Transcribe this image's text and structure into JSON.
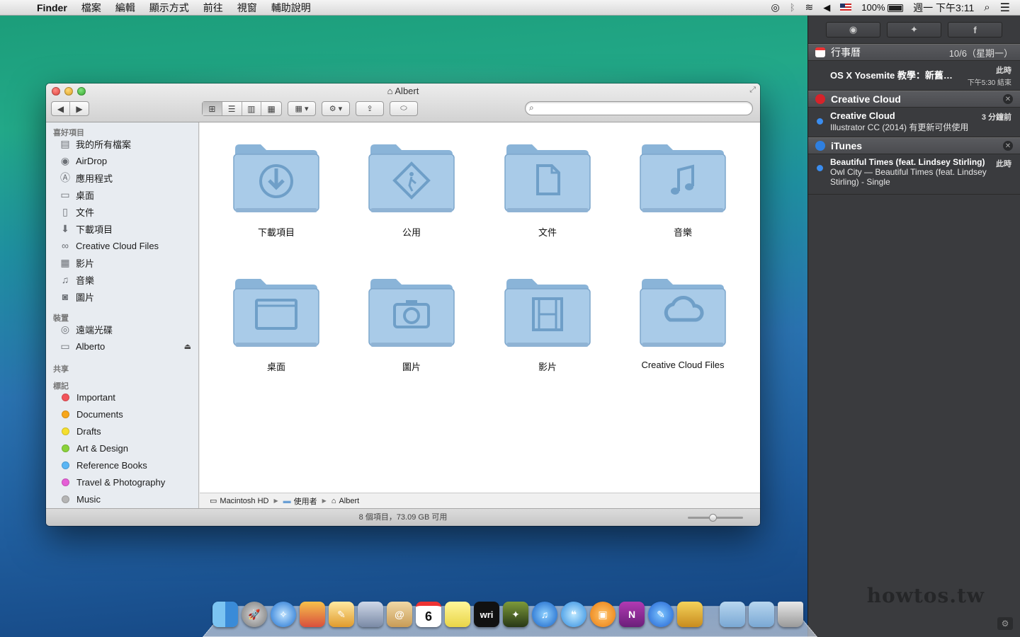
{
  "menubar": {
    "app": "Finder",
    "items": [
      "檔案",
      "編輯",
      "顯示方式",
      "前往",
      "視窗",
      "輔助說明"
    ],
    "battery": "100%",
    "clock": "週一 下午3:11"
  },
  "finder": {
    "title": "Albert",
    "search_placeholder": "",
    "sidebar": {
      "favorites_header": "喜好項目",
      "favorites": [
        "我的所有檔案",
        "AirDrop",
        "應用程式",
        "桌面",
        "文件",
        "下載項目",
        "Creative Cloud Files",
        "影片",
        "音樂",
        "圖片"
      ],
      "devices_header": "裝置",
      "devices": [
        "遠端光碟",
        "Alberto"
      ],
      "shared_header": "共享",
      "tags_header": "標記",
      "tags": [
        {
          "label": "Important",
          "color": "#f2545b"
        },
        {
          "label": "Documents",
          "color": "#f7a61b"
        },
        {
          "label": "Drafts",
          "color": "#f5df2e"
        },
        {
          "label": "Art & Design",
          "color": "#8ad23a"
        },
        {
          "label": "Reference Books",
          "color": "#5ab6f5"
        },
        {
          "label": "Travel & Photography",
          "color": "#e55fd6"
        },
        {
          "label": "Music",
          "color": "#b5b5b5"
        }
      ]
    },
    "folders": [
      {
        "label": "下載項目",
        "icon": "download-arrow-icon"
      },
      {
        "label": "公用",
        "icon": "public-sign-icon"
      },
      {
        "label": "文件",
        "icon": "document-icon"
      },
      {
        "label": "音樂",
        "icon": "music-note-icon"
      },
      {
        "label": "桌面",
        "icon": "desktop-screen-icon"
      },
      {
        "label": "圖片",
        "icon": "camera-icon"
      },
      {
        "label": "影片",
        "icon": "film-strip-icon"
      },
      {
        "label": "Creative Cloud Files",
        "icon": "creative-cloud-icon"
      }
    ],
    "pathbar": [
      "Macintosh HD",
      "使用者",
      "Albert"
    ],
    "status": "8 個項目，73.09 GB 可用",
    "icon_size_fraction": 0.45
  },
  "notification_center": {
    "calendar": {
      "app": "行事曆",
      "date": "10/6（星期一）",
      "event": "OS X Yosemite 教學：新舊…",
      "when": "此時",
      "end": "下午5:30 結束"
    },
    "creative_cloud": {
      "app": "Creative Cloud",
      "title": "Creative Cloud",
      "body": "Illustrator CC (2014) 有更新可供使用",
      "when": "3 分鐘前"
    },
    "itunes": {
      "app": "iTunes",
      "title": "Beautiful Times (feat. Lindsey Stirling)",
      "body": "Owl City — Beautiful Times (feat. Lindsey Stirling) - Single",
      "when": "此時"
    },
    "watermark": "howtos.tw"
  },
  "dock": {
    "calendar_day": "6",
    "writer_label": "wri",
    "onenote_label": "N"
  }
}
